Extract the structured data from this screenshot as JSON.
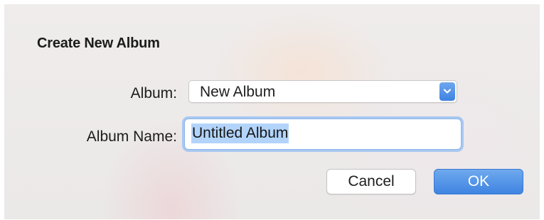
{
  "dialog": {
    "title": "Create New Album",
    "album_label": "Album:",
    "album_select_value": "New Album",
    "album_name_label": "Album Name:",
    "album_name_value": "Untitled Album",
    "cancel_label": "Cancel",
    "ok_label": "OK"
  },
  "icons": {
    "dropdown": "chevron-down-icon"
  },
  "colors": {
    "accent": "#3d82e0",
    "selection": "#b2d4fb",
    "focus_ring": "#a9c8f1"
  }
}
